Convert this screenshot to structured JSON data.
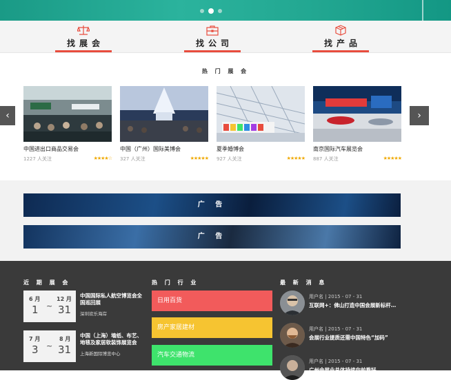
{
  "carousel": {
    "dot_count": 3,
    "active_dot": 2
  },
  "nav": [
    {
      "label": "找展会",
      "icon": "scale-icon",
      "active": true
    },
    {
      "label": "找公司",
      "icon": "briefcase-icon",
      "active": true
    },
    {
      "label": "找产品",
      "icon": "box-icon",
      "active": true
    }
  ],
  "hot_exhibitions": {
    "title": "热 门 展 会",
    "prev_icon": "chevron-left-icon",
    "next_icon": "chevron-right-icon",
    "cards": [
      {
        "name": "中国进出口商品交易会",
        "followers": "1227 人关注",
        "stars": "★★★★☆"
      },
      {
        "name": "中国（广州）国际美博会",
        "followers": "327 人关注",
        "stars": "★★★★★"
      },
      {
        "name": "夏季婚博会",
        "followers": "927 人关注",
        "stars": "★★★★★"
      },
      {
        "name": "南京国际汽车展览会",
        "followers": "887 人关注",
        "stars": "★★★★★"
      }
    ]
  },
  "ads": [
    {
      "label": "广 告"
    },
    {
      "label": "广 告"
    }
  ],
  "footer": {
    "recent": {
      "title": "近 期 展 会",
      "items": [
        {
          "start_month": "6 月",
          "start_day": "1",
          "tilde": "~",
          "end_month": "12 月",
          "end_day": "31",
          "title": "中国国际私人航空博览会全国巡回展",
          "place": "深圳欢乐海岸"
        },
        {
          "start_month": "7 月",
          "start_day": "3",
          "tilde": "~",
          "end_month": "8 月",
          "end_day": "31",
          "title": "中国（上海）墙纸、布艺、地毯及家居软装饰展览会",
          "place": "上海新国际博览中心"
        }
      ]
    },
    "industries": {
      "title": "热 门 行 业",
      "items": [
        {
          "label": "日用百货",
          "color": "#f25b5b"
        },
        {
          "label": "房产家居建材",
          "color": "#f6c431"
        },
        {
          "label": "汽车交通物流",
          "color": "#3ee36c"
        }
      ]
    },
    "news": {
      "title": "最 新 消 息",
      "items": [
        {
          "header": "用户名 | 2015 - 07 - 31",
          "text": "互联网+：佛山打造中国会展新标杆…"
        },
        {
          "header": "用户名 | 2015 - 07 - 31",
          "text": "会展行业提质还需中国特色“加码”"
        },
        {
          "header": "用户名 | 2015 - 07 - 31",
          "text": "广州会展业总体持续向前看好"
        }
      ]
    }
  },
  "colors": {
    "accent": "#e84c3d",
    "banner": "#22a791",
    "footer_bg": "#3a3a3a"
  }
}
